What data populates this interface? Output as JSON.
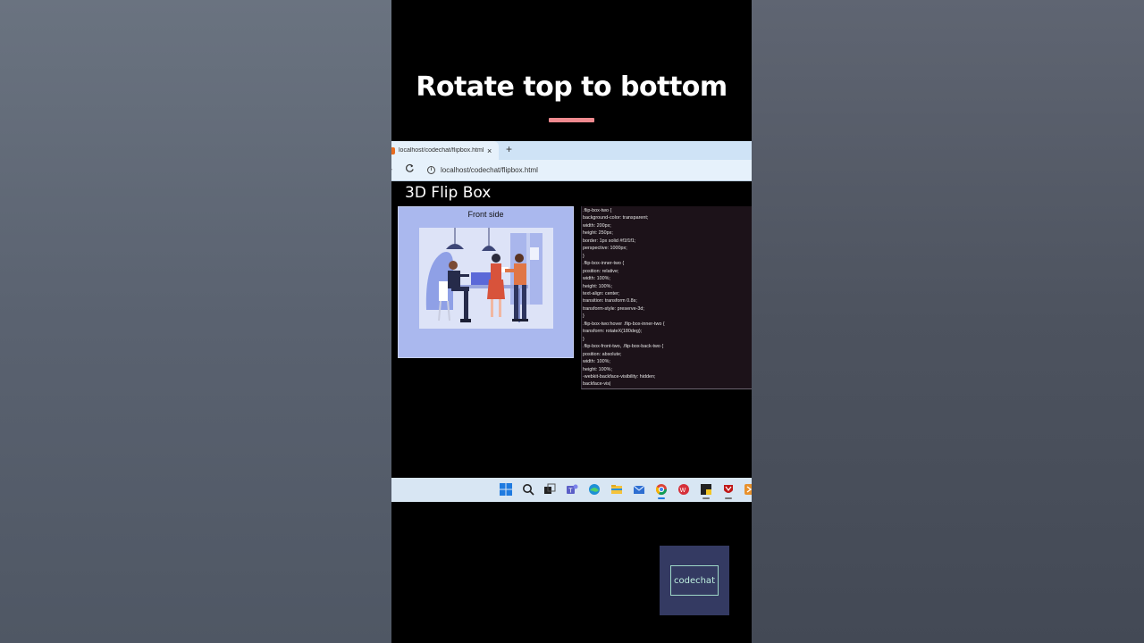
{
  "video": {
    "headline": "Rotate top to bottom",
    "accent_color": "#ef8a8f"
  },
  "browser": {
    "tab_title": "localhost/codechat/flipbox.html",
    "tab_close": "×",
    "new_tab": "+",
    "forward": "›",
    "reload": "C",
    "info": "i",
    "address": "localhost/codechat/flipbox.html"
  },
  "page": {
    "title": "3D Flip Box",
    "front_label": "Front side"
  },
  "code_lines": [
    ".flip-box-two {",
    "background-color: transparent;",
    "width: 200px;",
    "height: 250px;",
    "border: 1px solid #f1f1f1;",
    "perspective: 1000px;",
    "}",
    ".flip-box-inner-two {",
    "position: relative;",
    "width: 100%;",
    "height: 100%;",
    "text-align: center;",
    "transition: transform 0.8s;",
    "transform-style: preserve-3d;",
    "}",
    ".flip-box-two:hover .flip-box-inner-two {",
    "transform: rotateX(180deg);",
    "}",
    ".flip-box-front-two, .flip-box-back-two {",
    "position: absolute;",
    "width: 100%;",
    "height: 100%;",
    "-webkit-backface-visibility: hidden;",
    "backface-vis|"
  ],
  "taskbar": {
    "icons": [
      "windows-start-icon",
      "search-icon",
      "task-view-icon",
      "teams-icon",
      "edge-icon",
      "file-explorer-icon",
      "mail-icon",
      "chrome-icon",
      "wps-office-icon",
      "sticky-app-icon",
      "mcafee-icon",
      "app-icon"
    ]
  },
  "watermark": {
    "text": "codechat"
  }
}
